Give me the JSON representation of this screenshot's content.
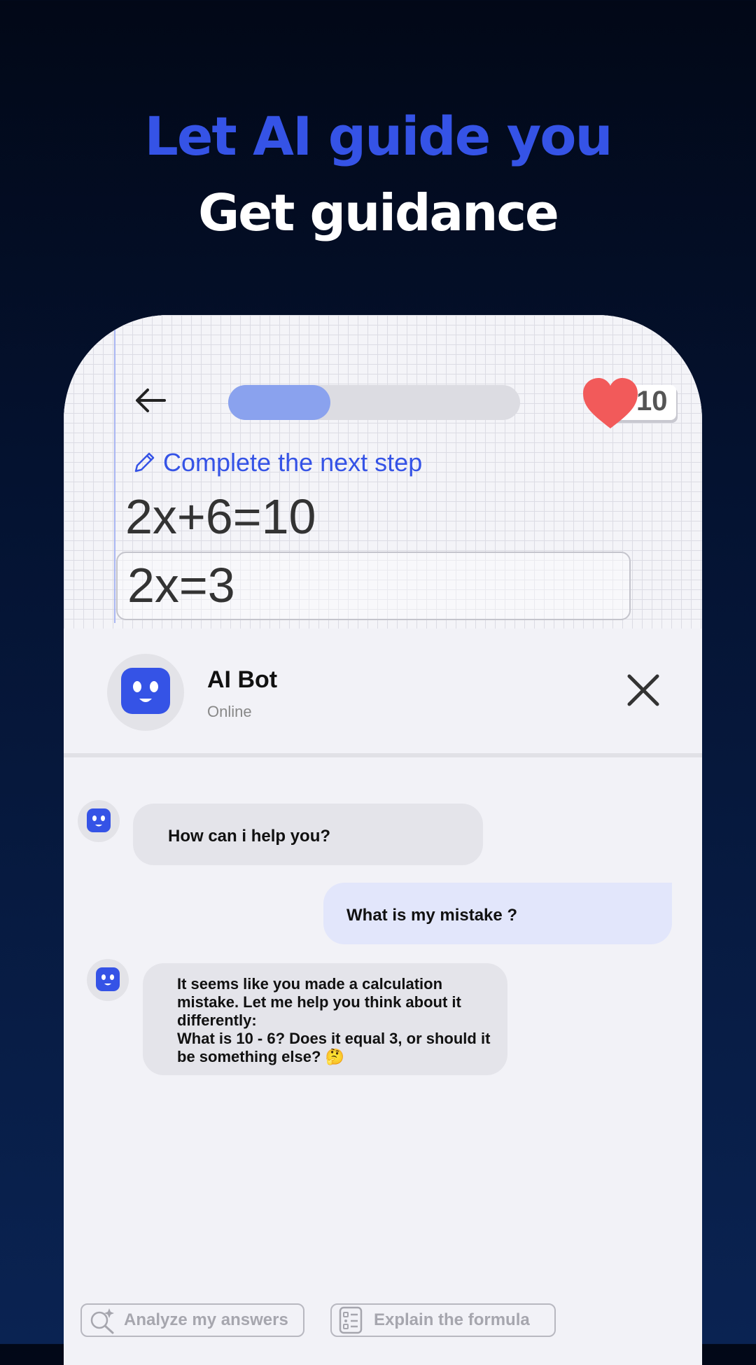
{
  "promo": {
    "headline": "Let AI guide you",
    "subheadline": "Get guidance"
  },
  "exercise": {
    "progress_fraction": 0.35,
    "lives": "10",
    "instruction": "Complete the next step",
    "equation": "2x+6=10",
    "answer": "2x=3"
  },
  "chat": {
    "bot_name": "AI Bot",
    "bot_status": "Online",
    "messages": [
      {
        "sender": "bot",
        "text": "How can i help you?"
      },
      {
        "sender": "user",
        "text": "What is my mistake ?"
      },
      {
        "sender": "bot",
        "text": "It seems like you made a calculation mistake. Let me help you think about it differently:\nWhat is 10 - 6? Does it equal 3, or should it be something else? 🤔"
      }
    ],
    "quick_actions": [
      {
        "label": "Analyze my answers",
        "icon": "sparkle-search-icon"
      },
      {
        "label": "Explain the formula",
        "icon": "formula-list-icon"
      }
    ]
  },
  "colors": {
    "accent": "#3553e6",
    "heart": "#f25a5a",
    "progress_fill": "#8aa2ee"
  }
}
